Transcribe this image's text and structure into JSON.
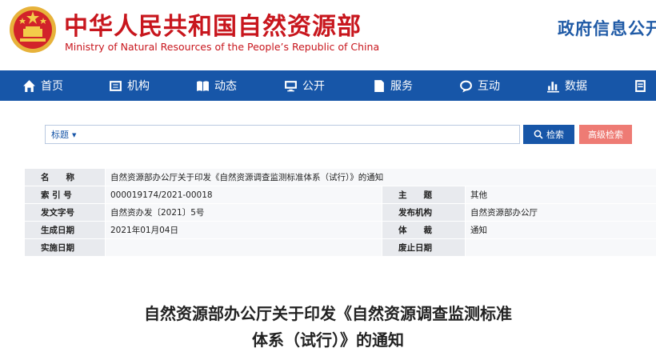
{
  "header": {
    "site_name_cn": "中华人民共和国自然资源部",
    "site_name_en": "Ministry of Natural Resources of the People’s Republic of China",
    "section_title": "政府信息公开"
  },
  "nav": {
    "items": [
      {
        "label": "首页",
        "icon": "home-icon"
      },
      {
        "label": "机构",
        "icon": "org-icon"
      },
      {
        "label": "动态",
        "icon": "news-icon"
      },
      {
        "label": "公开",
        "icon": "monitor-icon"
      },
      {
        "label": "服务",
        "icon": "service-icon"
      },
      {
        "label": "互动",
        "icon": "chat-icon"
      },
      {
        "label": "数据",
        "icon": "chart-icon"
      },
      {
        "label": "",
        "icon": "more-icon"
      }
    ]
  },
  "search": {
    "field_label": "标题",
    "value": "",
    "placeholder": "",
    "search_label": "检索",
    "advanced_label": "高级检索"
  },
  "info": {
    "name_label": "名　　称",
    "name_value": "自然资源部办公厅关于印发《自然资源调查监测标准体系（试行）》的通知",
    "index_label": "索 引 号",
    "index_value": "000019174/2021-00018",
    "subject_label": "主　　题",
    "subject_value": "其他",
    "doc_no_label": "发文字号",
    "doc_no_value": "自然资办发〔2021〕5号",
    "issuer_label": "发布机构",
    "issuer_value": "自然资源部办公厅",
    "created_label": "生成日期",
    "created_value": "2021年01月04日",
    "genre_label": "体　　裁",
    "genre_value": "通知",
    "effective_label": "实施日期",
    "effective_value": "",
    "expiry_label": "废止日期",
    "expiry_value": ""
  },
  "article": {
    "title_line1": "自然资源部办公厅关于印发《自然资源调查监测标准",
    "title_line2": "体系（试行）》的通知"
  },
  "colors": {
    "brand_red": "#c8161d",
    "nav_blue": "#1756a8",
    "advanced_btn": "#ee7b74",
    "label_bg": "#e8eaee"
  }
}
